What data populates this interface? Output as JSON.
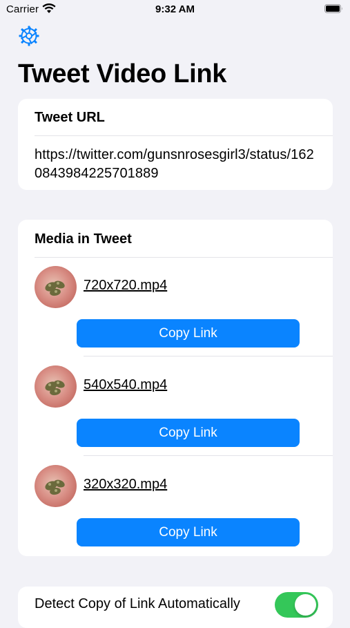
{
  "status_bar": {
    "carrier": "Carrier",
    "time": "9:32 AM",
    "icons": [
      "wifi-icon",
      "battery-icon"
    ]
  },
  "toolbar": {
    "settings_icon": "settings-gear-icon",
    "accent": "#0a84ff"
  },
  "page": {
    "title": "Tweet Video Link"
  },
  "tweet_url_section": {
    "header": "Tweet URL",
    "url": "https://twitter.com/gunsnrosesgirl3/status/1620843984225701889"
  },
  "media_section": {
    "header": "Media in Tweet",
    "items": [
      {
        "filename": "720x720.mp4",
        "button_label": "Copy Link"
      },
      {
        "filename": "540x540.mp4",
        "button_label": "Copy Link"
      },
      {
        "filename": "320x320.mp4",
        "button_label": "Copy Link"
      }
    ]
  },
  "settings_section": {
    "detect_copy_label": "Detect Copy of Link Automatically",
    "detect_copy_enabled": true,
    "toggle_on_color": "#34c759"
  }
}
